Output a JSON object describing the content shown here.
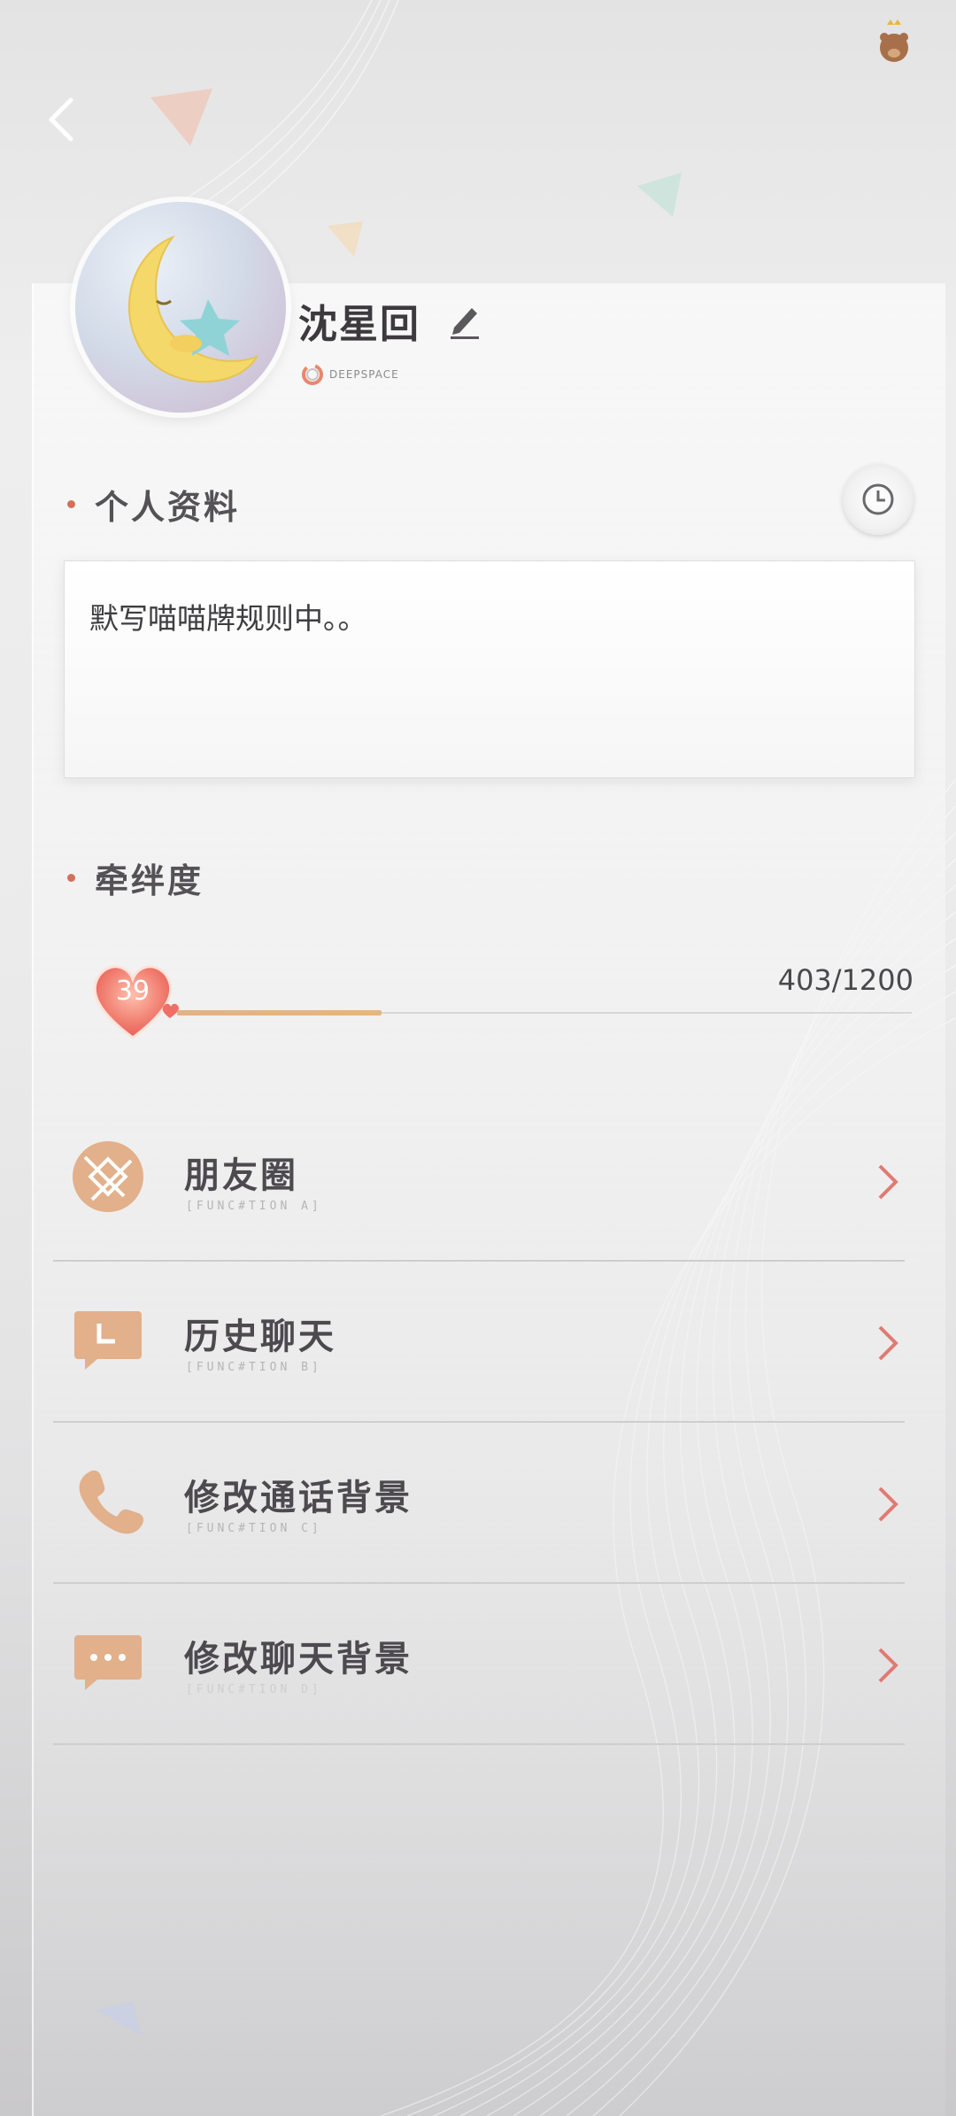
{
  "profile": {
    "name": "沈星回",
    "brand": "DEEPSPACE"
  },
  "sections": {
    "profile_title": "个人资料",
    "bond_title": "牵绊度"
  },
  "bio": {
    "text": "默写喵喵牌规则中。。"
  },
  "bond": {
    "level": "39",
    "progress_text": "403/1200",
    "current": 403,
    "max": 1200
  },
  "menu": [
    {
      "label": "朋友圈",
      "sub": "[FUNC#TION A]"
    },
    {
      "label": "历史聊天",
      "sub": "[FUNC#TION B]"
    },
    {
      "label": "修改通话背景",
      "sub": "[FUNC#TION C]"
    },
    {
      "label": "修改聊天背景",
      "sub": "[FUNC#TION D]"
    }
  ],
  "colors": {
    "accent_dot": "#d56f5b",
    "arrow": "#e07a72",
    "progress_fill": "#e2b285",
    "icon_bg": "#e3b18b"
  },
  "icons": {
    "back": "chevron-left-icon",
    "edit": "pencil-icon",
    "history": "clock-icon",
    "moments": "aperture-icon",
    "chat_history": "clock-chat-icon",
    "call": "phone-icon",
    "chat_bg": "chat-bubble-icon"
  }
}
